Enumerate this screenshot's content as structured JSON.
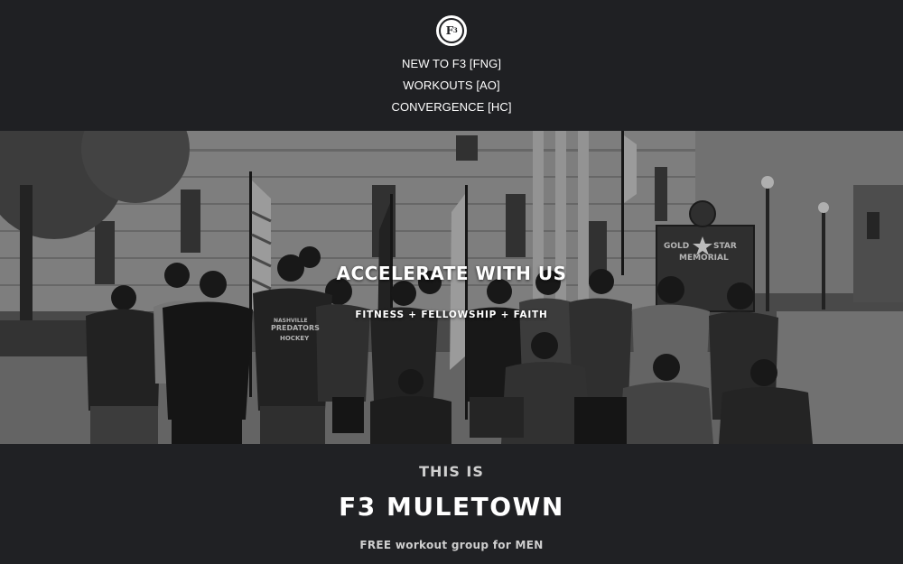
{
  "header": {
    "logo_text": "F3",
    "logo_icon": "f3-logo-icon",
    "nav": [
      {
        "label": "NEW TO F3 [FNG]"
      },
      {
        "label": "WORKOUTS [AO]"
      },
      {
        "label": "CONVERGENCE [HC]"
      }
    ]
  },
  "hero": {
    "title": "ACCELERATE WITH US",
    "subtitle": "FITNESS + FELLOWSHIP + FAITH",
    "photo_subject": "group-photo",
    "sign_text_1": "GOLD",
    "sign_text_2": "STAR",
    "sign_text_3": "MEMORIAL",
    "shirt_text_1": "NASHVILLE",
    "shirt_text_2": "PREDATORS",
    "shirt_text_3": "HOCKEY"
  },
  "intro": {
    "eyebrow": "THIS IS",
    "title": "F3 MULETOWN",
    "tagline": "FREE workout group for MEN"
  },
  "colors": {
    "header_bg": "#1f2023",
    "section_bg": "#202124",
    "text_primary": "#ffffff",
    "text_muted": "#cfcfcf"
  }
}
